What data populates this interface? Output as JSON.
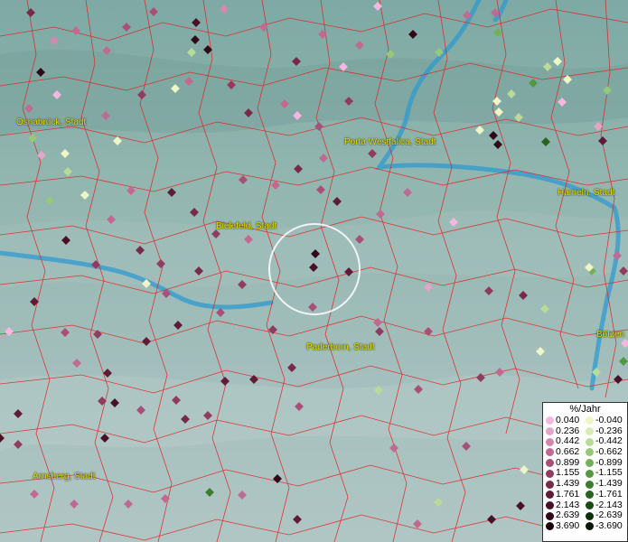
{
  "cities": [
    {
      "id": "osnabrueck",
      "name": "Osnabrück, Stadt"
    },
    {
      "id": "porta",
      "name": "Porta Westfalica, Stadt"
    },
    {
      "id": "hameln",
      "name": "Hameln, Stadt"
    },
    {
      "id": "bielefeld",
      "name": "Bielefeld, Stadt"
    },
    {
      "id": "paderborn",
      "name": "Paderborn, Stadt"
    },
    {
      "id": "bottrop",
      "name": "Bötzen"
    },
    {
      "id": "arnsberg",
      "name": "Arnsberg, Stadt"
    }
  ],
  "legend": {
    "title": "%/Jahr",
    "positive": [
      {
        "value": "0.040",
        "color": "#f4b8e0"
      },
      {
        "value": "0.236",
        "color": "#e6a4c8"
      },
      {
        "value": "0.442",
        "color": "#d488ae"
      },
      {
        "value": "0.662",
        "color": "#c06a92"
      },
      {
        "value": "0.899",
        "color": "#a85078"
      },
      {
        "value": "1.155",
        "color": "#903c60"
      },
      {
        "value": "1.439",
        "color": "#782a4a"
      },
      {
        "value": "1.761",
        "color": "#601c36"
      },
      {
        "value": "2.143",
        "color": "#481226"
      },
      {
        "value": "2.639",
        "color": "#300a18"
      },
      {
        "value": "3.690",
        "color": "#18040a"
      }
    ],
    "negative": [
      {
        "value": "-0.040",
        "color": "#eef6c8"
      },
      {
        "value": "-0.236",
        "color": "#d6ecb0"
      },
      {
        "value": "-0.442",
        "color": "#b8dc98"
      },
      {
        "value": "-0.662",
        "color": "#96c87a"
      },
      {
        "value": "-0.899",
        "color": "#74b05c"
      },
      {
        "value": "-1.155",
        "color": "#559842"
      },
      {
        "value": "-1.439",
        "color": "#3c7e2e"
      },
      {
        "value": "-1.761",
        "color": "#28641e"
      },
      {
        "value": "-2.143",
        "color": "#184a12"
      },
      {
        "value": "-2.639",
        "color": "#0c300a"
      },
      {
        "value": "-3.690",
        "color": "#041a04"
      }
    ]
  },
  "colors": {
    "river": "#2f9ad0",
    "border": "#e02020",
    "terrain": "#8fb3ad"
  }
}
